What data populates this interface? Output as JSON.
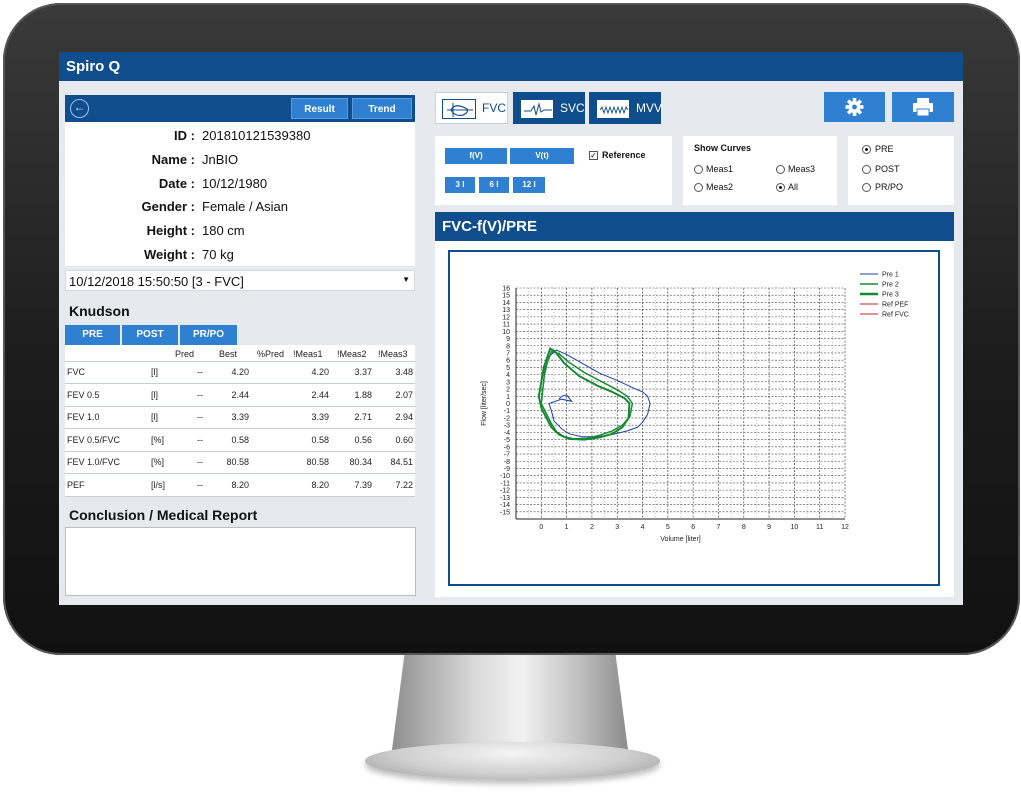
{
  "app": {
    "title": "Spiro Q"
  },
  "left_panel": {
    "back_icon": "arrow-left-circle-icon",
    "result_label": "Result",
    "trend_label": "Trend",
    "patient": [
      {
        "label": "ID :",
        "value": "201810121539380"
      },
      {
        "label": "Name :",
        "value": "JnBIO"
      },
      {
        "label": "Date :",
        "value": "10/12/1980"
      },
      {
        "label": "Gender :",
        "value": "Female / Asian"
      },
      {
        "label": "Height :",
        "value": "180 cm"
      },
      {
        "label": "Weight :",
        "value": "70 kg"
      }
    ],
    "session_select": "10/12/2018 15:50:50  [3 - FVC]",
    "reference_set": "Knudson",
    "mode_buttons": [
      "PRE",
      "POST",
      "PR/PO"
    ],
    "table": {
      "headers": [
        "Pred",
        "Best",
        "%Pred",
        "!Meas1",
        "!Meas2",
        "!Meas3"
      ],
      "rows": [
        {
          "param": "FVC",
          "unit": "[l]",
          "pred": "--",
          "best": "4.20",
          "pct": "",
          "m1": "4.20",
          "m2": "3.37",
          "m3": "3.48"
        },
        {
          "param": "FEV 0.5",
          "unit": "[l]",
          "pred": "--",
          "best": "2.44",
          "pct": "",
          "m1": "2.44",
          "m2": "1.88",
          "m3": "2.07"
        },
        {
          "param": "FEV 1.0",
          "unit": "[l]",
          "pred": "--",
          "best": "3.39",
          "pct": "",
          "m1": "3.39",
          "m2": "2.71",
          "m3": "2.94"
        },
        {
          "param": "FEV 0.5/FVC",
          "unit": "[%]",
          "pred": "--",
          "best": "0.58",
          "pct": "",
          "m1": "0.58",
          "m2": "0.56",
          "m3": "0.60"
        },
        {
          "param": "FEV 1.0/FVC",
          "unit": "[%]",
          "pred": "--",
          "best": "80.58",
          "pct": "",
          "m1": "80.58",
          "m2": "80.34",
          "m3": "84.51"
        },
        {
          "param": "PEF",
          "unit": "[l/s]",
          "pred": "--",
          "best": "8.20",
          "pct": "",
          "m1": "8.20",
          "m2": "7.39",
          "m3": "7.22"
        }
      ]
    },
    "conclusion_title": "Conclusion / Medical Report",
    "conclusion_text": ""
  },
  "right_panel": {
    "tabs": [
      {
        "label": "FVC",
        "icon": "flow-volume-loop-icon",
        "selected": true
      },
      {
        "label": "SVC",
        "icon": "volume-wave-icon",
        "selected": false
      },
      {
        "label": "MVV",
        "icon": "zigzag-wave-icon",
        "selected": false
      }
    ],
    "settings_icon": "gear-icon",
    "print_icon": "printer-icon",
    "curve_buttons": [
      "f(V)",
      "V(t)"
    ],
    "scale_buttons": [
      "3 l",
      "6 l",
      "12 l"
    ],
    "reference_label": "Reference",
    "reference_checked": true,
    "show_curves": {
      "title": "Show Curves",
      "options": [
        "Meas1",
        "Meas3",
        "Meas2",
        "All"
      ],
      "selected": "All"
    },
    "phase": {
      "options": [
        "PRE",
        "POST",
        "PR/PO"
      ],
      "selected": "PRE"
    },
    "chart_title": "FVC-f(V)/PRE",
    "colors": {
      "primary": "#0f4d8c",
      "button": "#2f80d0",
      "pre1": "#1f3fa8",
      "pre2": "#1a8a3a",
      "pre3": "#138a2e",
      "ref": "#cc2222"
    }
  },
  "chart_data": {
    "type": "line",
    "title": "",
    "xlabel": "Volume [liter]",
    "ylabel": "Flow [liter/sec]",
    "xlim": [
      -1,
      12
    ],
    "ylim": [
      -16,
      16
    ],
    "xticks": [
      0,
      1,
      2,
      3,
      4,
      5,
      6,
      7,
      8,
      9,
      10,
      11,
      12
    ],
    "yticks": [
      16,
      15,
      14,
      13,
      12,
      11,
      10,
      9,
      8,
      7,
      6,
      5,
      4,
      3,
      2,
      1,
      0,
      -1,
      -2,
      -3,
      -4,
      -5,
      -6,
      -7,
      -8,
      -9,
      -10,
      -11,
      -12,
      -13,
      -14,
      -15
    ],
    "legend_position": "top-right",
    "legend": [
      "Pre 1",
      "Pre 2",
      "Pre 3",
      "Ref PEF",
      "Ref FVC"
    ],
    "series": [
      {
        "name": "Pre 1",
        "color": "#1f3fa8",
        "width": 1,
        "x": [
          0.0,
          0.1,
          0.3,
          0.6,
          1.0,
          1.6,
          2.3,
          3.0,
          3.6,
          4.0,
          4.2,
          4.3,
          4.2,
          4.0,
          3.8,
          3.4,
          2.8,
          2.2,
          1.6,
          1.1,
          0.8,
          0.5,
          0.4,
          0.3,
          0.8,
          1.2,
          1.0,
          0.8,
          0.7
        ],
        "y": [
          0.0,
          3.5,
          6.5,
          7.4,
          6.8,
          5.6,
          4.2,
          3.2,
          2.2,
          1.6,
          1.0,
          0.0,
          -1.5,
          -2.6,
          -3.3,
          -3.8,
          -4.3,
          -4.6,
          -4.6,
          -4.2,
          -3.5,
          -2.4,
          -1.0,
          0.0,
          0.6,
          0.3,
          1.2,
          1.0,
          0.6
        ]
      },
      {
        "name": "Pre 2",
        "color": "#1a8a3a",
        "width": 1.5,
        "x": [
          0.0,
          0.15,
          0.4,
          0.7,
          1.1,
          1.7,
          2.4,
          3.0,
          3.4,
          3.6,
          3.5,
          3.2,
          2.8,
          2.3,
          1.8,
          1.3,
          0.9,
          0.6,
          0.4,
          0.2,
          0.0
        ],
        "y": [
          0.0,
          4.8,
          7.2,
          6.9,
          5.7,
          4.3,
          3.0,
          1.9,
          1.0,
          0.0,
          -1.8,
          -3.0,
          -3.8,
          -4.4,
          -4.8,
          -4.9,
          -4.6,
          -3.9,
          -2.8,
          -1.4,
          0.0
        ]
      },
      {
        "name": "Pre 3",
        "color": "#138a2e",
        "width": 2,
        "x": [
          -0.1,
          0.1,
          0.35,
          0.55,
          0.9,
          1.5,
          2.2,
          2.8,
          3.3,
          3.48,
          3.45,
          3.2,
          2.8,
          2.3,
          1.7,
          1.1,
          0.7,
          0.4,
          0.2,
          0.0,
          -0.1
        ],
        "y": [
          1.0,
          5.0,
          7.6,
          7.2,
          5.6,
          3.8,
          2.5,
          1.6,
          0.7,
          0.0,
          -2.0,
          -3.3,
          -4.2,
          -4.7,
          -5.0,
          -4.9,
          -4.3,
          -3.3,
          -2.0,
          -0.6,
          1.0
        ]
      }
    ]
  }
}
